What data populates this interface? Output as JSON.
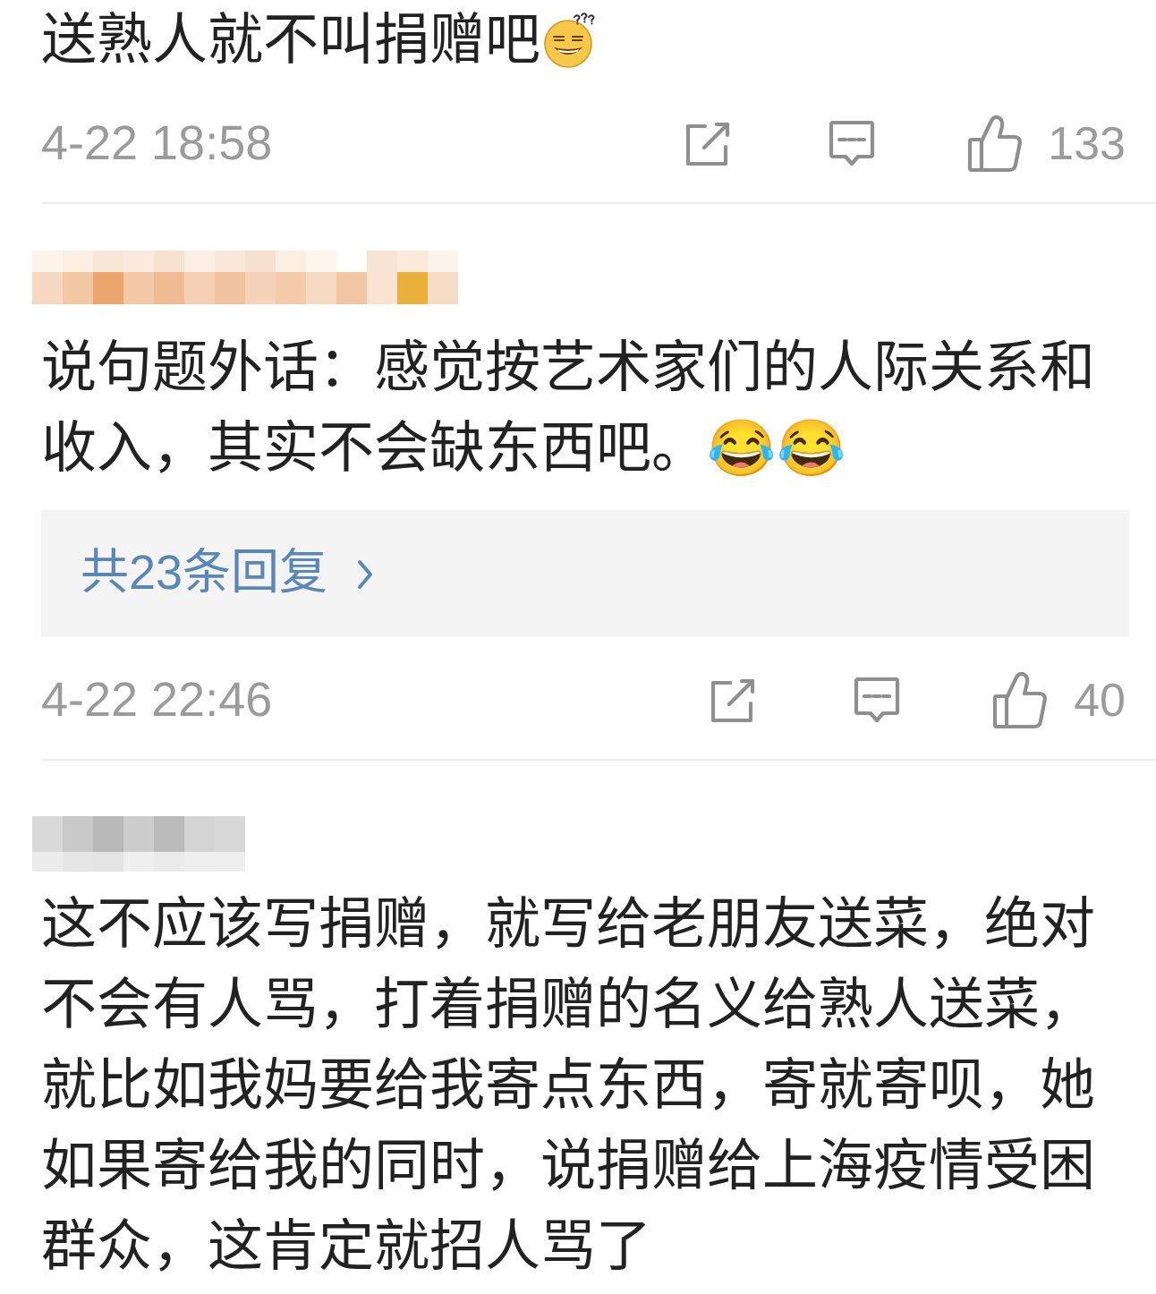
{
  "comments": [
    {
      "text": "送熟人就不叫捐赠吧",
      "emojis": [
        {
          "kind": "confused"
        }
      ],
      "time": "4-22 18:58",
      "likes": "133"
    },
    {
      "author_mosaic": {
        "kind": "tinted"
      },
      "text": "说句题外话：感觉按艺术家们的人际关系和收入，其实不会缺东西吧。😂😂",
      "replies": "共23条回复",
      "time": "4-22 22:46",
      "likes": "40"
    },
    {
      "author_mosaic": {
        "kind": "plain"
      },
      "text": "这不应该写捐赠，就写给老朋友送菜，绝对不会有人骂，打着捐赠的名义给熟人送菜，就比如我妈要给我寄点东西，寄就寄呗，她如果寄给我的同时，说捐赠给上海疫情受困群众，这肯定就招人骂了"
    }
  ]
}
